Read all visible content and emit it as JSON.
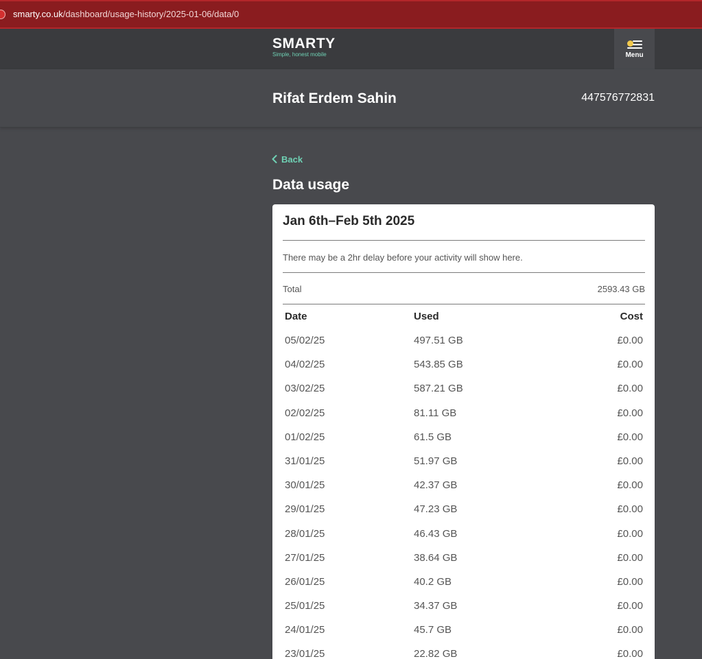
{
  "browser": {
    "url_host": "smarty.co.uk",
    "url_path": "/dashboard/usage-history/2025-01-06/data/0"
  },
  "nav": {
    "logo": "SMARTY",
    "tagline": "Simple, honest mobile",
    "menu_label": "Menu"
  },
  "account": {
    "name": "Rifat Erdem Sahin",
    "number": "447576772831"
  },
  "page": {
    "back_label": "Back",
    "title": "Data usage"
  },
  "usage": {
    "period": "Jan 6th–Feb 5th 2025",
    "notice": "There may be a 2hr delay before your activity will show here.",
    "total_label": "Total",
    "total_value": "2593.43 GB",
    "headers": {
      "date": "Date",
      "used": "Used",
      "cost": "Cost"
    },
    "rows": [
      {
        "date": "05/02/25",
        "used": "497.51 GB",
        "cost": "£0.00"
      },
      {
        "date": "04/02/25",
        "used": "543.85 GB",
        "cost": "£0.00"
      },
      {
        "date": "03/02/25",
        "used": "587.21 GB",
        "cost": "£0.00"
      },
      {
        "date": "02/02/25",
        "used": "81.11 GB",
        "cost": "£0.00"
      },
      {
        "date": "01/02/25",
        "used": "61.5 GB",
        "cost": "£0.00"
      },
      {
        "date": "31/01/25",
        "used": "51.97 GB",
        "cost": "£0.00"
      },
      {
        "date": "30/01/25",
        "used": "42.37 GB",
        "cost": "£0.00"
      },
      {
        "date": "29/01/25",
        "used": "47.23 GB",
        "cost": "£0.00"
      },
      {
        "date": "28/01/25",
        "used": "46.43 GB",
        "cost": "£0.00"
      },
      {
        "date": "27/01/25",
        "used": "38.64 GB",
        "cost": "£0.00"
      },
      {
        "date": "26/01/25",
        "used": "40.2 GB",
        "cost": "£0.00"
      },
      {
        "date": "25/01/25",
        "used": "34.37 GB",
        "cost": "£0.00"
      },
      {
        "date": "24/01/25",
        "used": "45.7 GB",
        "cost": "£0.00"
      },
      {
        "date": "23/01/25",
        "used": "22.82 GB",
        "cost": "£0.00"
      }
    ]
  },
  "icons": {
    "site": "site-settings-icon",
    "menu": "menu-icon",
    "back": "chevron-left-icon"
  },
  "colors": {
    "accent": "#6fd1b4",
    "background": "#48494d",
    "nav": "#3a3b3e",
    "urlbar": "#8a1c1f"
  }
}
